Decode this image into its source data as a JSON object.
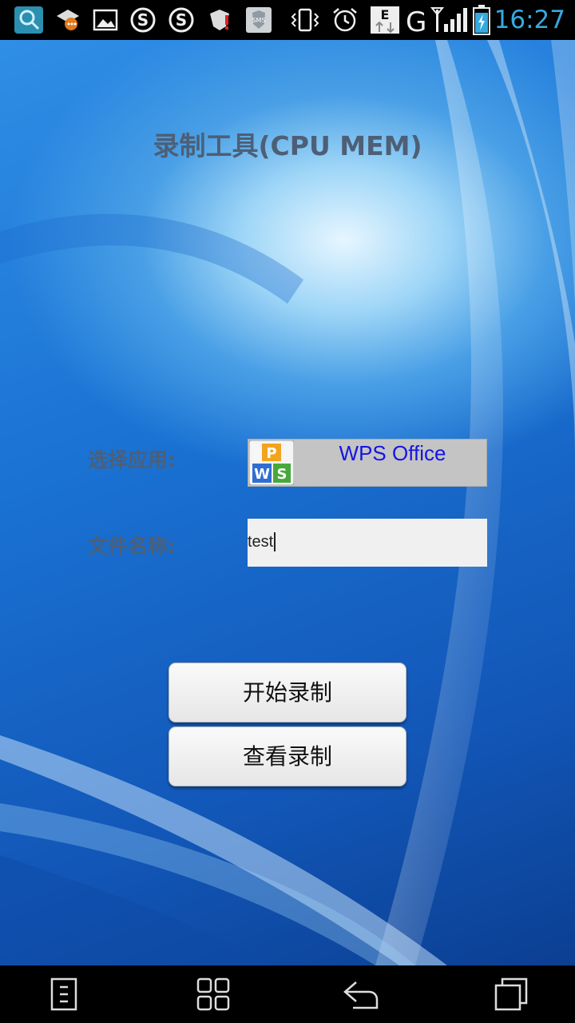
{
  "status_bar": {
    "time": "16:27",
    "network": "G",
    "data_indicator": "E",
    "sms_label": "SMS",
    "icons": [
      "search-app-icon",
      "chat-notification-icon",
      "image-notification-icon",
      "s-app-icon",
      "s-app-icon",
      "shield-alert-icon",
      "sms-icon",
      "vibrate-icon",
      "alarm-icon",
      "data-arrows-icon",
      "signal-icon",
      "battery-charging-icon"
    ]
  },
  "app": {
    "title": "录制工具(CPU MEM)",
    "select_app_label": "选择应用:",
    "selected_app": "WPS Office",
    "file_name_label": "文件名称:",
    "file_name_value": "test",
    "start_button": "开始录制",
    "view_button": "查看录制"
  },
  "nav_bar": {
    "icons": [
      "menu-icon",
      "home-grid-icon",
      "back-icon",
      "recent-apps-icon"
    ]
  },
  "colors": {
    "label_text": "#4d5f76",
    "app_name_text": "#1414e6",
    "clock": "#36a9e0"
  }
}
